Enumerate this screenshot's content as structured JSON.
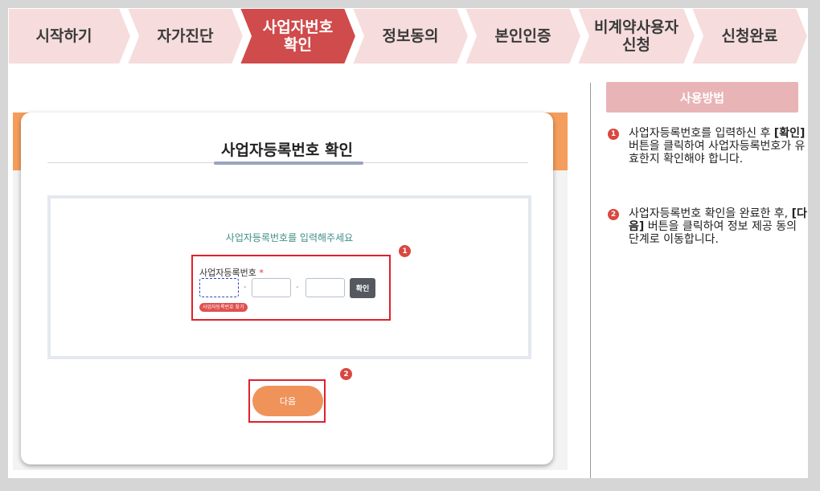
{
  "colors": {
    "step_inactive": "#f6dcdc",
    "step_active": "#d04b4b",
    "accent_orange": "#f0935a",
    "header_pink": "#e8b4b6",
    "highlight_red": "#e0202c"
  },
  "steps": [
    {
      "label": "시작하기",
      "active": false
    },
    {
      "label": "자가진단",
      "active": false
    },
    {
      "label": "사업자번호\n확인",
      "active": true
    },
    {
      "label": "정보동의",
      "active": false
    },
    {
      "label": "본인인증",
      "active": false
    },
    {
      "label": "비계약사용자\n신청",
      "active": false
    },
    {
      "label": "신청완료",
      "active": false
    }
  ],
  "card": {
    "title": "사업자등록번호 확인",
    "prompt": "사업자등록번호를 입력해주세요",
    "field_label": "사업자등록번호",
    "required_mark": "*",
    "dash": "-",
    "inputs": {
      "first": "",
      "second": "",
      "third": ""
    },
    "confirm_label": "확인",
    "find_label": "사업자등록번호 찾기",
    "next_label": "다음"
  },
  "markers": {
    "one": "1",
    "two": "2"
  },
  "panel": {
    "header": "사용방법",
    "tips": [
      {
        "number": "1",
        "before": "사업자등록번호를 입력하신 후 ",
        "bold": "[확인]",
        "after": " 버튼을 클릭하여 사업자등록번호가 유효한지 확인해야 합니다."
      },
      {
        "number": "2",
        "before": "사업자등록번호 확인을 완료한 후, ",
        "bold": "[다음]",
        "after": " 버튼을 클릭하여 정보 제공 동의 단계로 이동합니다."
      }
    ]
  }
}
